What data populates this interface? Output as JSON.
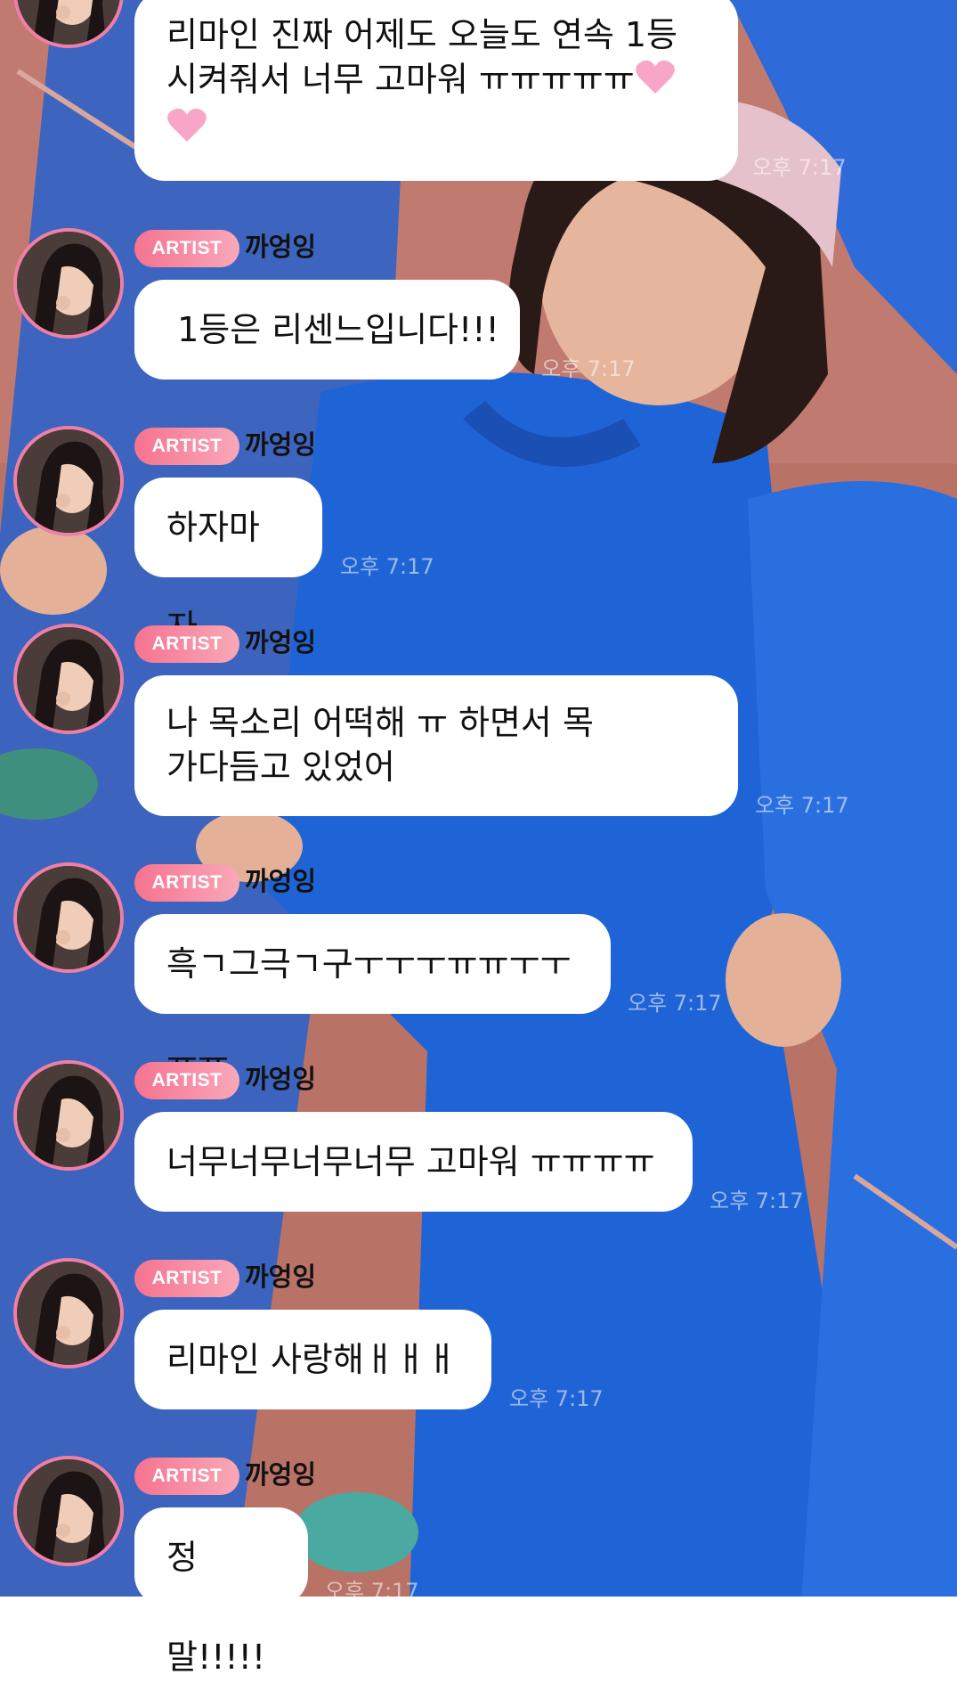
{
  "sender": {
    "badge": "ARTIST",
    "name": "까엉잉"
  },
  "colors": {
    "badge_gradient_start": "#f6738f",
    "badge_gradient_end": "#f9a8b9",
    "avatar_ring": "#f07fa8",
    "bubble_bg": "#ffffff"
  },
  "messages": [
    {
      "text_line1": "리마인 진짜 어제도 오늘도 연속 1등",
      "text_line2": "시켜줘서 너무 고마워 ㅠㅠㅠㅠㅠ",
      "emoji": "pink-heart-icon",
      "time": "오후 7:17"
    },
    {
      "text": " 1등은 리센느입니다!!!",
      "time": "오후 7:17"
    },
    {
      "text": "하자마자",
      "time": "오후 7:17"
    },
    {
      "text_line1": "나 목소리 어떡해 ㅠ 하면서 목",
      "text_line2": "가다듬고 있었어",
      "time": "오후 7:17"
    },
    {
      "text": "흑ㄱ그극ㄱ구ㅜㅜㅜㅠㅠㅜㅜㅠㅠ",
      "time": "오후 7:17"
    },
    {
      "text": "너무너무너무너무 고마워 ㅠㅠㅠㅠ",
      "time": "오후 7:17"
    },
    {
      "text": "리마인 사랑해ㅐㅐㅐ",
      "time": "오후 7:17"
    },
    {
      "text": "정말!!!!!",
      "time": "오후 7:17"
    }
  ]
}
